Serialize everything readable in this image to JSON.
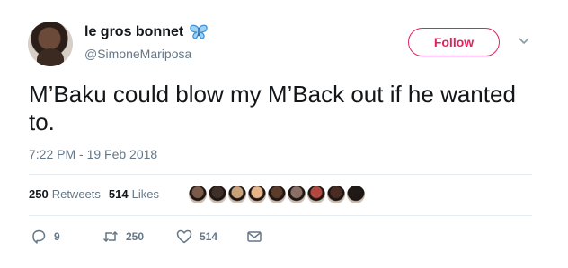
{
  "user": {
    "display_name": "le gros bonnet",
    "handle": "@SimoneMariposa",
    "emoji_icon": "butterfly-icon"
  },
  "follow_label": "Follow",
  "tweet": {
    "text": "M’Baku could blow my M’Back out if he wanted to.",
    "timestamp": "7:22 PM - 19 Feb 2018"
  },
  "stats": {
    "retweets_count": "250",
    "retweets_label": "Retweets",
    "likes_count": "514",
    "likes_label": "Likes"
  },
  "liker_avatar_colors": [
    "#7a5a48",
    "#3e2f28",
    "#c9a27a",
    "#e7b58a",
    "#5b3b2a",
    "#8a6f66",
    "#b0483f",
    "#4a2c24",
    "#1f1a18"
  ],
  "actions": {
    "reply_count": "9",
    "retweet_count": "250",
    "like_count": "514"
  },
  "colors": {
    "accent": "#e0245e",
    "secondary_text": "#657786",
    "primary_text": "#14171a",
    "divider": "#e6ecf0",
    "butterfly": "#3b8fd9"
  }
}
